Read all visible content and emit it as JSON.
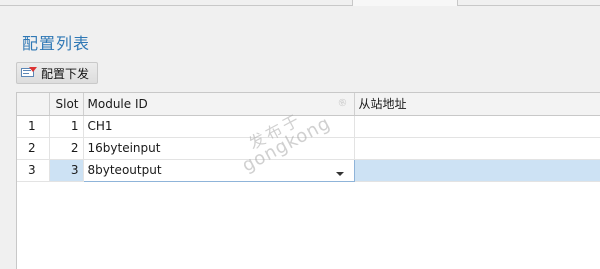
{
  "page": {
    "title": "配置列表"
  },
  "toolbar": {
    "deploy_label": "配置下发",
    "deploy_icon": "mail-send-icon"
  },
  "grid": {
    "columns": [
      "",
      "Slot",
      "Module ID",
      "从站地址"
    ],
    "rows": [
      {
        "index": "1",
        "slot": "1",
        "module_id": "CH1",
        "slave_address": ""
      },
      {
        "index": "2",
        "slot": "2",
        "module_id": "16byteinput",
        "slave_address": ""
      },
      {
        "index": "3",
        "slot": "3",
        "module_id": "8byteoutput",
        "slave_address": ""
      }
    ],
    "selected_row": 3
  },
  "watermark": {
    "line1": "发布于",
    "line2": "gongkong",
    "mark": "®"
  },
  "colors": {
    "title": "#2f78b5",
    "selection": "#cde2f4"
  }
}
